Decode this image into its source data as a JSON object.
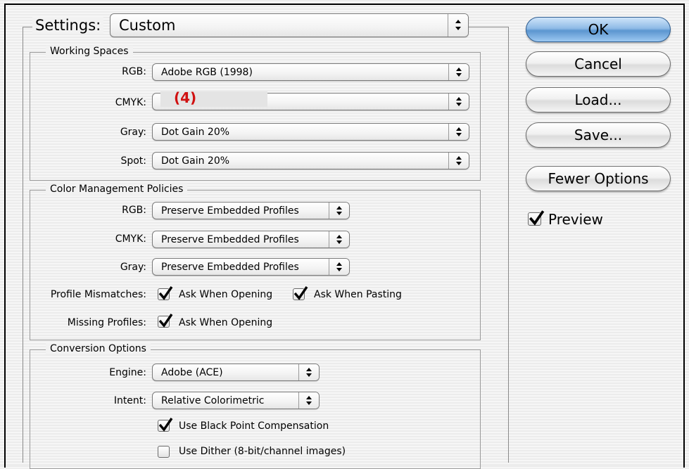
{
  "settings": {
    "label": "Settings:",
    "value": "Custom"
  },
  "working_spaces": {
    "title": "Working Spaces",
    "rows": [
      {
        "label": "RGB:",
        "value": "Adobe RGB (1998)"
      },
      {
        "label": "CMYK:",
        "value": ""
      },
      {
        "label": "Gray:",
        "value": "Dot Gain 20%"
      },
      {
        "label": "Spot:",
        "value": "Dot Gain 20%"
      }
    ],
    "annotation": "(4)"
  },
  "policies": {
    "title": "Color Management Policies",
    "rows": [
      {
        "label": "RGB:",
        "value": "Preserve Embedded Profiles"
      },
      {
        "label": "CMYK:",
        "value": "Preserve Embedded Profiles"
      },
      {
        "label": "Gray:",
        "value": "Preserve Embedded Profiles"
      }
    ],
    "profile_mismatches": {
      "label": "Profile Mismatches:",
      "ask_opening": "Ask When Opening",
      "ask_pasting": "Ask When Pasting"
    },
    "missing_profiles": {
      "label": "Missing Profiles:",
      "ask_opening": "Ask When Opening"
    }
  },
  "conversion": {
    "title": "Conversion Options",
    "engine_label": "Engine:",
    "engine_value": "Adobe (ACE)",
    "intent_label": "Intent:",
    "intent_value": "Relative Colorimetric",
    "black_point": "Use Black Point Compensation",
    "dither": "Use Dither (8-bit/channel images)"
  },
  "buttons": {
    "ok": "OK",
    "cancel": "Cancel",
    "load": "Load...",
    "save": "Save...",
    "fewer": "Fewer Options"
  },
  "preview": {
    "label": "Preview",
    "checked": true
  },
  "colors": {
    "default_button": "#8fbbe6",
    "annotation": "#d01010"
  }
}
